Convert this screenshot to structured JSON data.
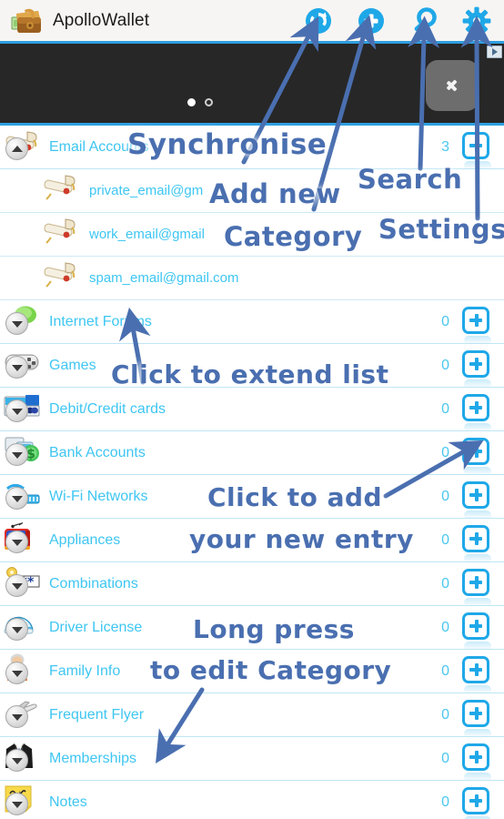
{
  "app": {
    "title": "ApolloWallet",
    "logo_icon": "wallet-icon"
  },
  "toolbar": {
    "buttons": [
      {
        "name": "sync-button",
        "icon": "refresh-icon",
        "label": "Synchronise"
      },
      {
        "name": "add-button",
        "icon": "plus-icon",
        "label": "Add new Category"
      },
      {
        "name": "search-button",
        "icon": "search-icon",
        "label": "Search"
      },
      {
        "name": "settings-button",
        "icon": "gear-icon",
        "label": "Settings"
      }
    ]
  },
  "ad": {
    "next_icon": "chevron-right-icon",
    "adchoices_icon": "adchoices-icon",
    "dots": [
      "filled",
      "hollow"
    ]
  },
  "list": [
    {
      "type": "category",
      "label": "Email Accounts",
      "count": "3",
      "icon": "scroll-icon",
      "expanded": true,
      "add_icon": "plus-square-icon"
    },
    {
      "type": "entry",
      "label": "private_email@gm",
      "icon": "scroll-icon"
    },
    {
      "type": "entry",
      "label": "work_email@gmail",
      "icon": "scroll-icon"
    },
    {
      "type": "entry",
      "label": "spam_email@gmail.com",
      "icon": "scroll-icon"
    },
    {
      "type": "category",
      "label": "Internet Forums",
      "count": "0",
      "icon": "chat-bubbles-icon",
      "expanded": false,
      "add_icon": "plus-square-icon"
    },
    {
      "type": "category",
      "label": "Games",
      "count": "0",
      "icon": "gamepad-icon",
      "expanded": false,
      "add_icon": "plus-square-icon"
    },
    {
      "type": "category",
      "label": "Debit/Credit cards",
      "count": "0",
      "icon": "credit-card-icon",
      "expanded": false,
      "add_icon": "plus-square-icon"
    },
    {
      "type": "category",
      "label": "Bank Accounts",
      "count": "0",
      "icon": "dollar-icon",
      "expanded": false,
      "add_icon": "plus-square-icon"
    },
    {
      "type": "category",
      "label": "Wi-Fi Networks",
      "count": "0",
      "icon": "wifi-icon",
      "expanded": false,
      "add_icon": "plus-square-icon"
    },
    {
      "type": "category",
      "label": "Appliances",
      "count": "0",
      "icon": "television-icon",
      "expanded": false,
      "add_icon": "plus-square-icon"
    },
    {
      "type": "category",
      "label": "Combinations",
      "count": "0",
      "icon": "key-password-icon",
      "expanded": false,
      "add_icon": "plus-square-icon"
    },
    {
      "type": "category",
      "label": "Driver License",
      "count": "0",
      "icon": "car-icon",
      "expanded": false,
      "add_icon": "plus-square-icon"
    },
    {
      "type": "category",
      "label": "Family Info",
      "count": "0",
      "icon": "person-icon",
      "expanded": false,
      "add_icon": "plus-square-icon"
    },
    {
      "type": "category",
      "label": "Frequent Flyer",
      "count": "0",
      "icon": "airplane-icon",
      "expanded": false,
      "add_icon": "plus-square-icon"
    },
    {
      "type": "category",
      "label": "Memberships",
      "count": "0",
      "icon": "suit-icon",
      "expanded": false,
      "add_icon": "plus-square-icon"
    },
    {
      "type": "category",
      "label": "Notes",
      "count": "0",
      "icon": "notepad-icon",
      "expanded": false,
      "add_icon": "plus-square-icon"
    }
  ],
  "annotations": [
    {
      "name": "annotation-synchronise",
      "text": "Synchronise"
    },
    {
      "name": "annotation-add-new",
      "text": "Add new"
    },
    {
      "name": "annotation-category",
      "text": "Category"
    },
    {
      "name": "annotation-search",
      "text": "Search"
    },
    {
      "name": "annotation-settings",
      "text": "Settings"
    },
    {
      "name": "annotation-extend-list",
      "text": "Click to extend list"
    },
    {
      "name": "annotation-click-to-add",
      "text": "Click to add"
    },
    {
      "name": "annotation-new-entry",
      "text": "your new entry"
    },
    {
      "name": "annotation-long-press",
      "text": "Long press"
    },
    {
      "name": "annotation-edit-category",
      "text": "to edit Category"
    }
  ],
  "colors": {
    "accent": "#1fa8e8",
    "label": "#3ec6f2",
    "annotation": "#4a6fb0",
    "actionbar_bg": "#f7f5f3",
    "ad_bg": "#272727"
  }
}
